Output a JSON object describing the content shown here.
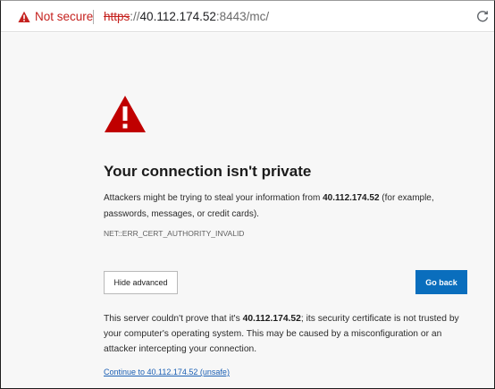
{
  "address_bar": {
    "security_label": "Not secure",
    "url_scheme": "https",
    "url_separator": "://",
    "url_host": "40.112.174.52",
    "url_rest": ":8443/mc/"
  },
  "error_page": {
    "heading": "Your connection isn't private",
    "description_pre": "Attackers might be trying to steal your information from ",
    "description_host": "40.112.174.52",
    "description_post": " (for example, passwords, messages, or credit cards).",
    "error_code": "NET::ERR_CERT_AUTHORITY_INVALID",
    "hide_advanced_label": "Hide advanced",
    "go_back_label": "Go back",
    "explanation_pre": "This server couldn't prove that it's ",
    "explanation_host": "40.112.174.52",
    "explanation_post": "; its security certificate is not trusted by your computer's operating system. This may be caused by a misconfiguration or an attacker intercepting your connection.",
    "continue_link": "Continue to 40.112.174.52 (unsafe)"
  },
  "icons": {
    "security": "warning-triangle-icon",
    "page": "warning-triangle-icon",
    "reload": "refresh-icon"
  },
  "colors": {
    "warning_red": "#c5221f",
    "big_warning_red": "#c00000",
    "primary_button": "#0a6ebd",
    "link": "#1a5fb4",
    "page_background": "#f7f7f7"
  }
}
